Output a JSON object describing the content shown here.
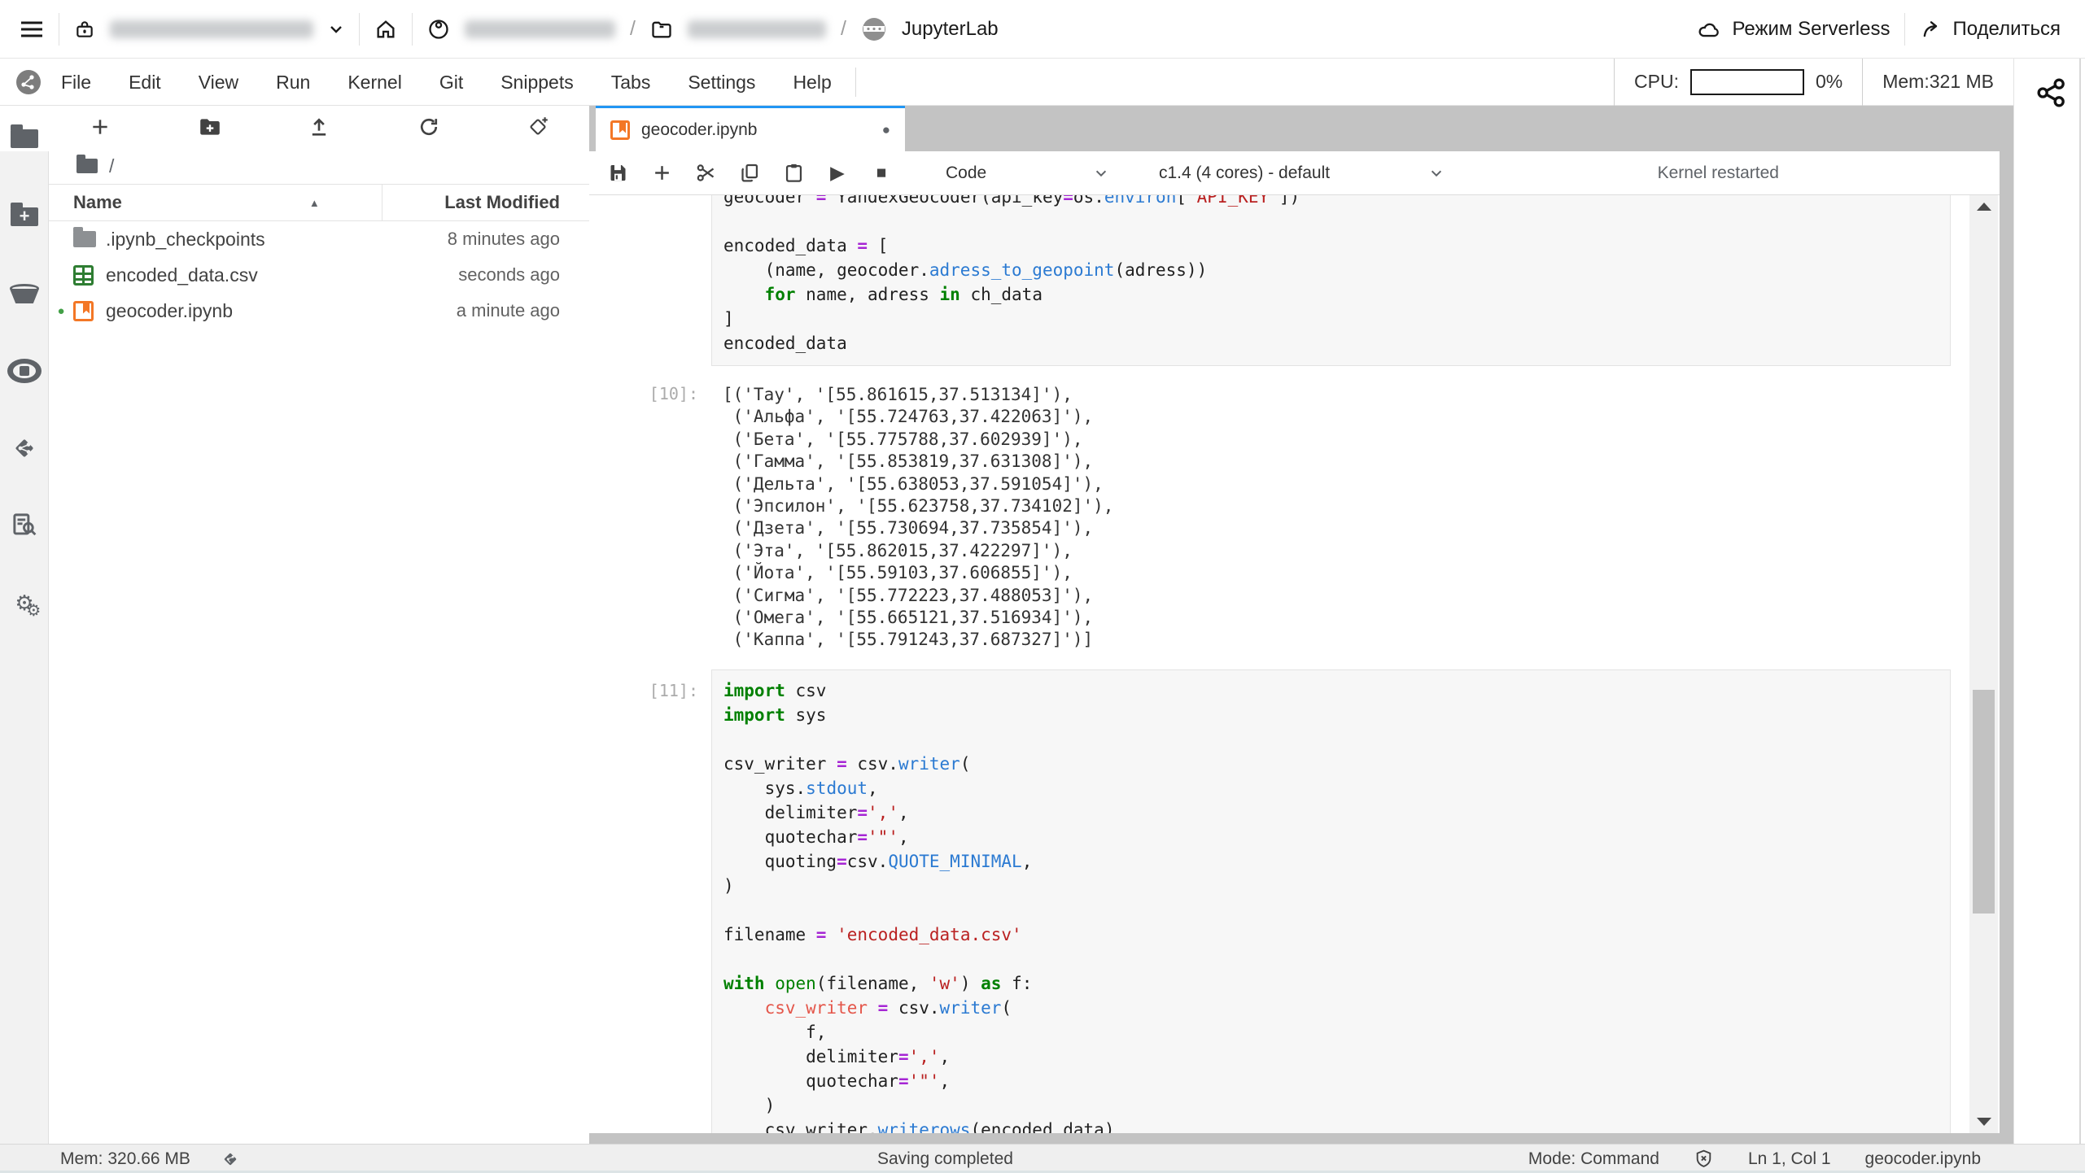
{
  "header": {
    "product": "JupyterLab",
    "serverless_label": "Режим Serverless",
    "share_label": "Поделиться",
    "path_sep": "/"
  },
  "menubar": {
    "items": [
      "File",
      "Edit",
      "View",
      "Run",
      "Kernel",
      "Git",
      "Snippets",
      "Tabs",
      "Settings",
      "Help"
    ],
    "cpu_label": "CPU:",
    "cpu_value": "0%",
    "mem_value": "Mem:321 MB"
  },
  "filebrowser": {
    "breadcrumb_root": "/",
    "columns": {
      "name": "Name",
      "modified": "Last Modified"
    },
    "files": [
      {
        "name": ".ipynb_checkpoints",
        "modified": "8 minutes ago",
        "icon": "folder-icon",
        "running": false
      },
      {
        "name": "encoded_data.csv",
        "modified": "seconds ago",
        "icon": "csv-icon",
        "running": false
      },
      {
        "name": "geocoder.ipynb",
        "modified": "a minute ago",
        "icon": "notebook-icon",
        "running": true
      }
    ]
  },
  "tabbar": {
    "active_tab": "geocoder.ipynb"
  },
  "nbtoolbar": {
    "cell_type": "Code",
    "kernel": "c1.4 (4 cores) - default",
    "status": "Kernel restarted"
  },
  "notebook": {
    "cells": [
      {
        "kind": "code",
        "prompt": "",
        "lines": [
          [
            [
              "t",
              "geocoder "
            ],
            [
              "o",
              "="
            ],
            [
              "t",
              " YandexGeocoder(api_key"
            ],
            [
              "o",
              "="
            ],
            [
              "t",
              "os."
            ],
            [
              "p",
              "environ"
            ],
            [
              "t",
              "["
            ],
            [
              "s",
              "'API_KEY'"
            ],
            [
              "t",
              "])"
            ]
          ],
          [],
          [
            [
              "t",
              "encoded_data "
            ],
            [
              "o",
              "="
            ],
            [
              "t",
              " ["
            ]
          ],
          [
            [
              "t",
              "    (name, geocoder."
            ],
            [
              "p",
              "adress_to_geopoint"
            ],
            [
              "t",
              "(adress))"
            ]
          ],
          [
            [
              "t",
              "    "
            ],
            [
              "k",
              "for"
            ],
            [
              "t",
              " name, adress "
            ],
            [
              "k",
              "in"
            ],
            [
              "t",
              " ch_data"
            ]
          ],
          [
            [
              "t",
              "]"
            ]
          ],
          [
            [
              "t",
              "encoded_data"
            ]
          ]
        ]
      },
      {
        "kind": "output",
        "prompt": "[10]:",
        "lines": [
          "[('Тау', '[55.861615,37.513134]'),",
          " ('Альфа', '[55.724763,37.422063]'),",
          " ('Бета', '[55.775788,37.602939]'),",
          " ('Гамма', '[55.853819,37.631308]'),",
          " ('Дельта', '[55.638053,37.591054]'),",
          " ('Эпсилон', '[55.623758,37.734102]'),",
          " ('Дзета', '[55.730694,37.735854]'),",
          " ('Эта', '[55.862015,37.422297]'),",
          " ('Йота', '[55.59103,37.606855]'),",
          " ('Сигма', '[55.772223,37.488053]'),",
          " ('Омега', '[55.665121,37.516934]'),",
          " ('Каппа', '[55.791243,37.687327]')]"
        ]
      },
      {
        "kind": "code",
        "prompt": "[11]:",
        "lines": [
          [
            [
              "k",
              "import"
            ],
            [
              "t",
              " csv"
            ]
          ],
          [
            [
              "k",
              "import"
            ],
            [
              "t",
              " sys"
            ]
          ],
          [],
          [
            [
              "t",
              "csv_writer "
            ],
            [
              "o",
              "="
            ],
            [
              "t",
              " csv."
            ],
            [
              "p",
              "writer"
            ],
            [
              "t",
              "("
            ]
          ],
          [
            [
              "t",
              "    sys."
            ],
            [
              "p",
              "stdout"
            ],
            [
              "t",
              ","
            ]
          ],
          [
            [
              "t",
              "    delimiter"
            ],
            [
              "o",
              "="
            ],
            [
              "s",
              "','"
            ],
            [
              "t",
              ","
            ]
          ],
          [
            [
              "t",
              "    quotechar"
            ],
            [
              "o",
              "="
            ],
            [
              "s",
              "'\"'"
            ],
            [
              "t",
              ","
            ]
          ],
          [
            [
              "t",
              "    quoting"
            ],
            [
              "o",
              "="
            ],
            [
              "t",
              "csv."
            ],
            [
              "p",
              "QUOTE_MINIMAL"
            ],
            [
              "t",
              ","
            ]
          ],
          [
            [
              "t",
              ")"
            ]
          ],
          [],
          [
            [
              "t",
              "filename "
            ],
            [
              "o",
              "="
            ],
            [
              "t",
              " "
            ],
            [
              "s",
              "'encoded_data.csv'"
            ]
          ],
          [],
          [
            [
              "k",
              "with"
            ],
            [
              "t",
              " "
            ],
            [
              "b",
              "open"
            ],
            [
              "t",
              "(filename, "
            ],
            [
              "s",
              "'w'"
            ],
            [
              "t",
              ") "
            ],
            [
              "k",
              "as"
            ],
            [
              "t",
              " f:"
            ]
          ],
          [
            [
              "t",
              "    "
            ],
            [
              "v",
              "csv_writer"
            ],
            [
              "t",
              " "
            ],
            [
              "o",
              "="
            ],
            [
              "t",
              " csv."
            ],
            [
              "p",
              "writer"
            ],
            [
              "t",
              "("
            ]
          ],
          [
            [
              "t",
              "        f,"
            ]
          ],
          [
            [
              "t",
              "        delimiter"
            ],
            [
              "o",
              "="
            ],
            [
              "s",
              "','"
            ],
            [
              "t",
              ","
            ]
          ],
          [
            [
              "t",
              "        quotechar"
            ],
            [
              "o",
              "="
            ],
            [
              "s",
              "'\"'"
            ],
            [
              "t",
              ","
            ]
          ],
          [
            [
              "t",
              "    )"
            ]
          ],
          [
            [
              "t",
              "    csv_writer."
            ],
            [
              "u",
              "writerows"
            ],
            [
              "t",
              "(encoded_data)"
            ]
          ]
        ]
      }
    ]
  },
  "statusbar": {
    "mem": "Mem: 320.66 MB",
    "message": "Saving completed",
    "mode": "Mode: Command",
    "cursor": "Ln 1, Col 1",
    "file": "geocoder.ipynb"
  },
  "icons": {
    "run": "▶",
    "stop": "■",
    "dirty": "●",
    "sort_asc": "▲",
    "gear": "⚙"
  },
  "colors": {
    "accent_blue": "#2196f3",
    "jupyter_orange": "#f37726",
    "csv_green": "#2e7d32",
    "running_green": "#43a047"
  }
}
